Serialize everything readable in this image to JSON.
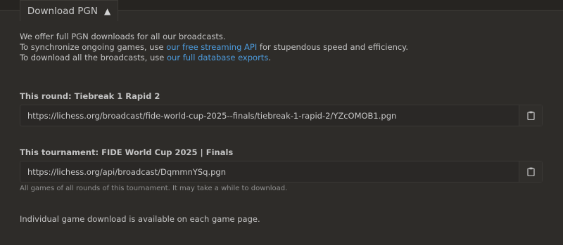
{
  "tab": {
    "label": "Download PGN",
    "arrow": "▲"
  },
  "intro": {
    "line1": "We offer full PGN downloads for all our broadcasts.",
    "line2_pre": "To synchronize ongoing games, use ",
    "line2_link": "our free streaming API",
    "line2_post": " for stupendous speed and efficiency.",
    "line3_pre": "To download all the broadcasts, use ",
    "line3_link": "our full database exports",
    "line3_post": "."
  },
  "round": {
    "label": "This round: Tiebreak 1 Rapid 2",
    "url": "https://lichess.org/broadcast/fide-world-cup-2025--finals/tiebreak-1-rapid-2/YZcOMOB1.pgn"
  },
  "tournament": {
    "label": "This tournament: FIDE World Cup 2025 | Finals",
    "url": "https://lichess.org/api/broadcast/DqmmnYSq.pgn",
    "note": "All games of all rounds of this tournament. It may take a while to download."
  },
  "footer": "Individual game download is available on each game page.",
  "colors": {
    "link": "#4d9ddf",
    "panel": "#2e2c29",
    "background": "#262421"
  },
  "icons": {
    "copy": "clipboard-icon"
  }
}
